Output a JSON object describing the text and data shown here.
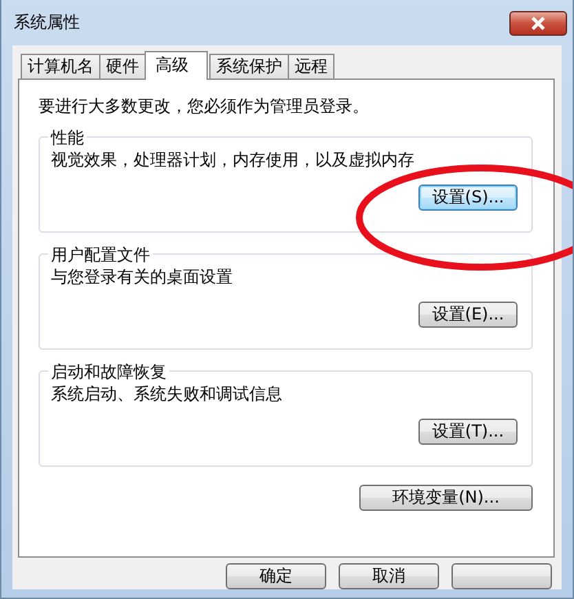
{
  "window": {
    "title": "系统属性"
  },
  "tabs": [
    {
      "label": "计算机名",
      "selected": false
    },
    {
      "label": "硬件",
      "selected": false
    },
    {
      "label": "高级",
      "selected": true
    },
    {
      "label": "系统保护",
      "selected": false
    },
    {
      "label": "远程",
      "selected": false
    }
  ],
  "notice": "要进行大多数更改，您必须作为管理员登录。",
  "groups": [
    {
      "title": "性能",
      "description": "视觉效果，处理器计划，内存使用，以及虚拟内存",
      "button": "设置(S)...",
      "focused": true
    },
    {
      "title": "用户配置文件",
      "description": "与您登录有关的桌面设置",
      "button": "设置(E)...",
      "focused": false
    },
    {
      "title": "启动和故障恢复",
      "description": "系统启动、系统失败和调试信息",
      "button": "设置(T)...",
      "focused": false
    }
  ],
  "env_button": "环境变量(N)...",
  "buttons": [
    "确定",
    "取消"
  ]
}
